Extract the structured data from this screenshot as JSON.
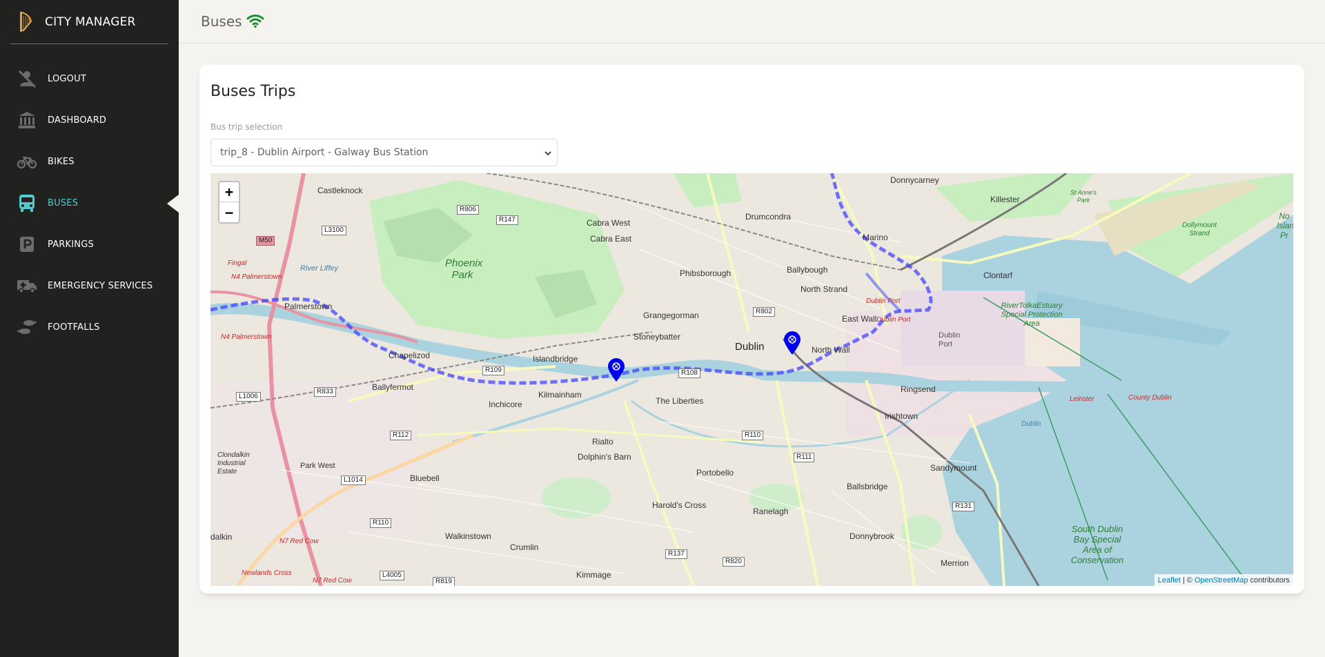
{
  "brand": {
    "name": "CITY MANAGER",
    "logo_icon": "harp-icon"
  },
  "sidebar": {
    "items": [
      {
        "label": "LOGOUT",
        "icon": "logout-icon",
        "active": false
      },
      {
        "label": "DASHBOARD",
        "icon": "bank-icon",
        "active": false
      },
      {
        "label": "BIKES",
        "icon": "bike-icon",
        "active": false
      },
      {
        "label": "BUSES",
        "icon": "bus-icon",
        "active": true
      },
      {
        "label": "PARKINGS",
        "icon": "parking-icon",
        "active": false
      },
      {
        "label": "EMERGENCY SERVICES",
        "icon": "ambulance-icon",
        "active": false
      },
      {
        "label": "FOOTFALLS",
        "icon": "footsteps-icon",
        "active": false
      }
    ],
    "active_color": "#51cbce"
  },
  "header": {
    "title": "Buses",
    "status_icon": "wifi-icon",
    "status_color": "#1a8f2d"
  },
  "card": {
    "title": "Buses Trips",
    "select_label": "Bus trip selection",
    "select_value": "trip_8 - Dublin Airport - Galway Bus Station"
  },
  "map": {
    "zoom_in": "+",
    "zoom_out": "−",
    "attribution": {
      "leaflet": "Leaflet",
      "sep": "| ©",
      "osm": "OpenStreetMap",
      "suffix": "contributors"
    },
    "route_color": "#3b3bff",
    "marker_color": "#0000ee",
    "labels": {
      "castleknock": "Castleknock",
      "cabra_west": "Cabra West",
      "cabra_east": "Cabra East",
      "drumcondra": "Drumcondra",
      "donnycarney": "Donnycarney",
      "killester": "Killester",
      "marino": "Marino",
      "clontarf": "Clontarf",
      "phibsborough": "Phibsborough",
      "ballybough": "Ballybough",
      "north_strand": "North Strand",
      "east_wall": "East Wall",
      "palmerstown": "Palmerstown",
      "chapelizod": "Chapelizod",
      "ballyfermot": "Ballyfermot",
      "grangegorman": "Grangegorman",
      "stoneybatter": "Stoneybatter",
      "dublin": "Dublin",
      "north_wall": "North Wall",
      "islandbridge": "Islandbridge",
      "kilmainham": "Kilmainham",
      "inchicore": "Inchicore",
      "the_liberties": "The Liberties",
      "ringsend": "Ringsend",
      "irishtown": "Irishtown",
      "rialto": "Rialto",
      "dolphins_barn": "Dolphin's Barn",
      "portobello": "Portobello",
      "sandymount": "Sandymount",
      "bluebell": "Bluebell",
      "ballsbridge": "Ballsbridge",
      "harolds_cross": "Harold's Cross",
      "ranelagh": "Ranelagh",
      "walkinstown": "Walkinstown",
      "crumlin": "Crumlin",
      "donnybrook": "Donnybrook",
      "kimmage": "Kimmage",
      "merrion": "Merrion",
      "park_west": "Park West",
      "clondalkin": "Clondalkin Industrial Estate",
      "dalkin": "dalkin",
      "phoenix_park": "Phoenix Park",
      "river_liffey": "River Liffey",
      "tolka": "RiverTolkaEstuary Special Protection Area",
      "dublin_port": "Dublin Port",
      "south_bay": "South Dublin Bay Special Area of Conservation",
      "n4_1": "N4 Palmerstown",
      "n4_2": "N4 Palmerstown",
      "n7_1": "N7 Red Cow",
      "n7_2": "N7 Red Cow",
      "newlands": "Newlands Cross",
      "leinster": "Leinster",
      "county_dublin": "County Dublin",
      "dublin_small": "Dublin",
      "dollymount": "Dollymount Strand",
      "nc_island": "No Islan Pr",
      "st_annes": "St Anne's Park",
      "fingal": "Fingal"
    },
    "shields": [
      "R806",
      "R147",
      "L3100",
      "M50",
      "R802",
      "R109",
      "R108",
      "R833",
      "L1006",
      "R112",
      "R110",
      "R111",
      "L1014",
      "R110",
      "R137",
      "R820",
      "L4005",
      "R819",
      "R131"
    ]
  }
}
